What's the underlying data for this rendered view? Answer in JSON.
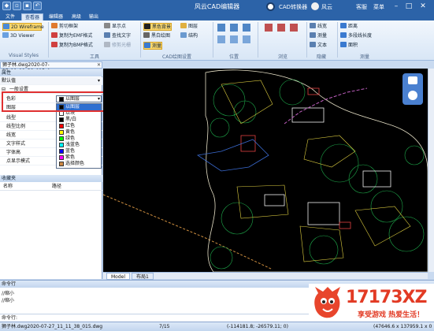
{
  "app": {
    "title": "风云CAD编辑器",
    "cad_converter": "CAD转换器",
    "user": "风云",
    "service": "客服",
    "menu": "菜单"
  },
  "menubar": [
    {
      "label": "文件",
      "active": false
    },
    {
      "label": "查看器",
      "active": true
    },
    {
      "label": "编辑器",
      "active": false
    },
    {
      "label": "高级",
      "active": false
    },
    {
      "label": "输出",
      "active": false
    }
  ],
  "ribbon": {
    "visual_styles": {
      "wireframe": "2D Wireframe",
      "viewer3d": "3D Viewer",
      "label": "Visual Styles"
    },
    "tools": {
      "items": [
        "剪切框架",
        "复制为EMF格式",
        "复制为BMP格式",
        "显示点",
        "查找文字",
        "修剪光栅"
      ],
      "label": "工具"
    },
    "cad_settings": {
      "items": [
        "黑色背景",
        "黑白绘图",
        "图层",
        "结构",
        "测量"
      ],
      "label": "CAD绘图设置"
    },
    "position_label": "位置",
    "browse_label": "浏览",
    "hide": {
      "items": [
        "线宽",
        "测量",
        "文本"
      ],
      "label": "隐藏"
    },
    "measure": {
      "items": [
        "距离",
        "多段线长度",
        "面积"
      ],
      "label": "测量"
    }
  },
  "doc_tab": "狮子林.dwg2020-07-27_11_11_38_015.dwg",
  "properties": {
    "header": "属性",
    "default_value": "默认值",
    "section": "一般设置",
    "rows": [
      {
        "key": "色彩",
        "value": "以图层"
      },
      {
        "key": "图层",
        "value": ""
      },
      {
        "key": "线型",
        "value": ""
      },
      {
        "key": "线型比例",
        "value": ""
      },
      {
        "key": "线宽",
        "value": ""
      },
      {
        "key": "文字样式",
        "value": ""
      },
      {
        "key": "字体高",
        "value": ""
      },
      {
        "key": "点显示模式",
        "value": ""
      }
    ],
    "color_options": [
      {
        "label": "以图层",
        "color": "#000000",
        "highlight": true
      },
      {
        "label": "以块",
        "color": "#ffffff",
        "highlight": false
      },
      {
        "label": "黑/白",
        "color": "#000000",
        "highlight": false
      },
      {
        "label": "红色",
        "color": "#ff0000",
        "highlight": false
      },
      {
        "label": "黄色",
        "color": "#ffff00",
        "highlight": false
      },
      {
        "label": "绿色",
        "color": "#00ff00",
        "highlight": false
      },
      {
        "label": "浅蓝色",
        "color": "#00ffff",
        "highlight": false
      },
      {
        "label": "蓝色",
        "color": "#0000ff",
        "highlight": false
      },
      {
        "label": "紫色",
        "color": "#ff00ff",
        "highlight": false
      },
      {
        "label": "选择颜色",
        "color": "#cc8844",
        "highlight": false
      }
    ]
  },
  "favorites": {
    "header": "收藏夹",
    "col_name": "名称",
    "col_path": "路径"
  },
  "model_tabs": [
    "Model",
    "布局1"
  ],
  "command": {
    "header": "命令行",
    "lines": [
      "//缩小",
      "//缩小"
    ],
    "prompt": "命令行:"
  },
  "status": {
    "file": "狮子林.dwg2020-07-27_11_11_38_015.dwg",
    "page": "7/15",
    "coords": "(-114181.8; -26579.11; 0)",
    "size": "(47646.6 x 137959.1 x 0"
  },
  "logo": {
    "text": "17173XZ",
    "slogan": "享受游戏 热爱生活！"
  }
}
